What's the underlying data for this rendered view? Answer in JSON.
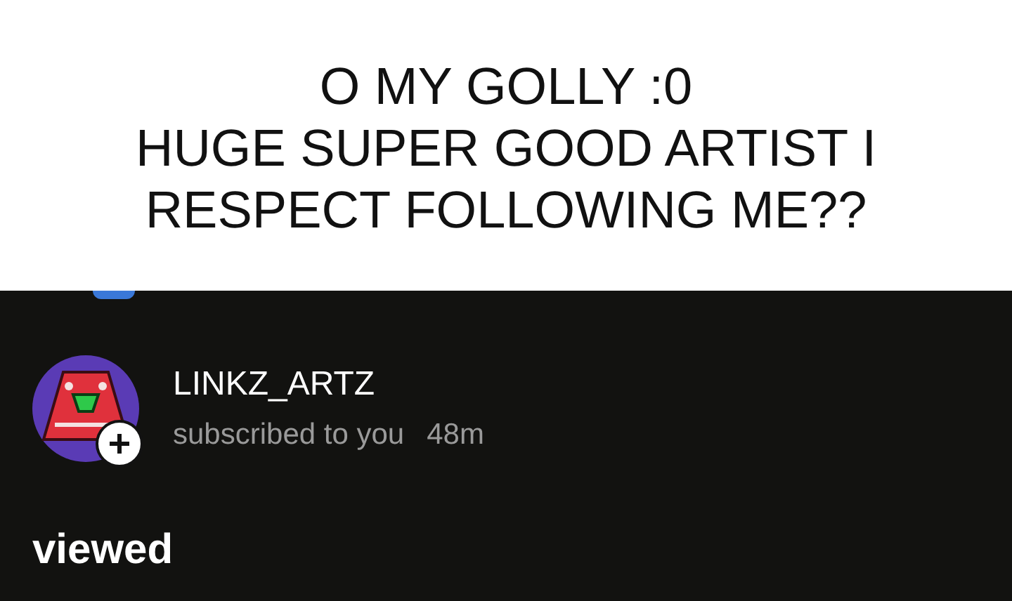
{
  "caption": [
    "O MY GOLLY :0",
    "HUGE SUPER GOOD ARTIST I",
    "RESPECT FOLLOWING ME??"
  ],
  "notification": {
    "name": "LINKZ_ARTZ",
    "action": "subscribed to you",
    "time": "48m"
  },
  "section_heading": "viewed"
}
